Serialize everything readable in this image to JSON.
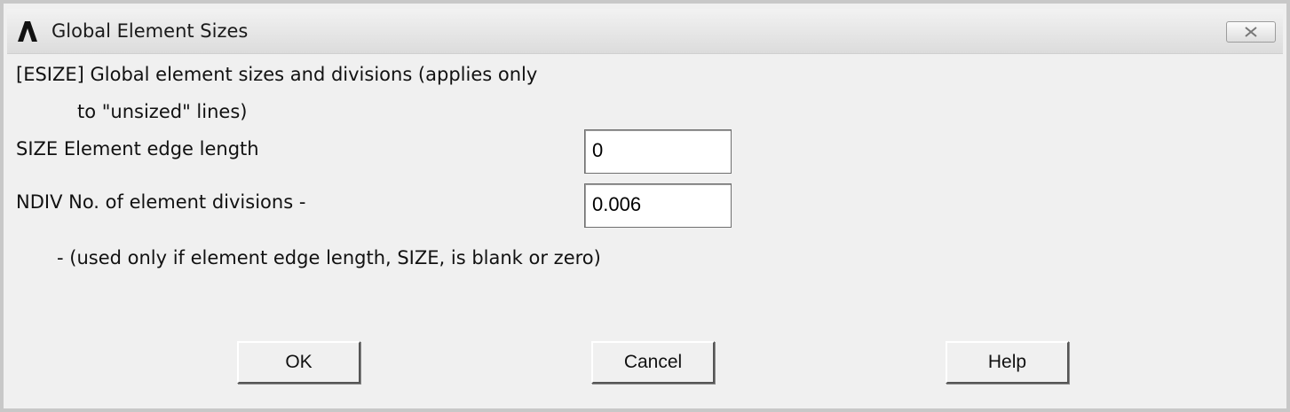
{
  "window": {
    "title": "Global Element Sizes",
    "app_icon": "ansys-logo-icon",
    "close_icon": "close-icon"
  },
  "form": {
    "header_line1": "[ESIZE]  Global element sizes and divisions (applies only",
    "header_line2": "to \"unsized\" lines)",
    "size_label": "SIZE  Element edge length",
    "size_value": "0",
    "ndiv_label": "NDIV  No. of element divisions -",
    "ndiv_value": "0.006",
    "note": "- (used only if element edge length, SIZE, is blank or zero)"
  },
  "buttons": {
    "ok": "OK",
    "cancel": "Cancel",
    "help": "Help"
  }
}
